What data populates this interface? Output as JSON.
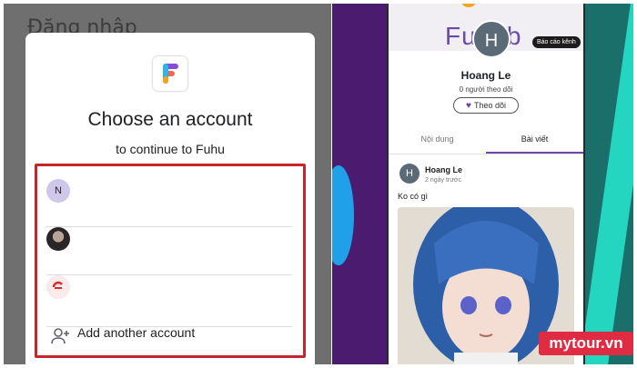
{
  "left": {
    "background_title": "Đăng nhập",
    "dialog": {
      "title": "Choose an account",
      "subtitle": "to continue to Fuhu",
      "accounts": [
        {
          "avatar_letter": "N",
          "avatar_type": "letter"
        },
        {
          "avatar_letter": "",
          "avatar_type": "photo"
        },
        {
          "avatar_letter": "",
          "avatar_type": "logo"
        }
      ],
      "add_account_label": "Add another account",
      "highlight_color": "#c4262e"
    }
  },
  "right": {
    "banner_text": "Fuhub",
    "report_label": "Báo cáo kênh",
    "profile": {
      "avatar_letter": "H",
      "name": "Hoang Le",
      "followers": "0 người theo dõi",
      "follow_button": "Theo dõi"
    },
    "tabs": [
      {
        "label": "Nội dung",
        "active": false
      },
      {
        "label": "Bài viết",
        "active": true
      }
    ],
    "post": {
      "avatar_letter": "H",
      "author": "Hoang Le",
      "time": "2 ngày trước",
      "text": "Ko có gì"
    },
    "accent_color": "#6b49a8"
  },
  "watermark": "mytour.vn"
}
